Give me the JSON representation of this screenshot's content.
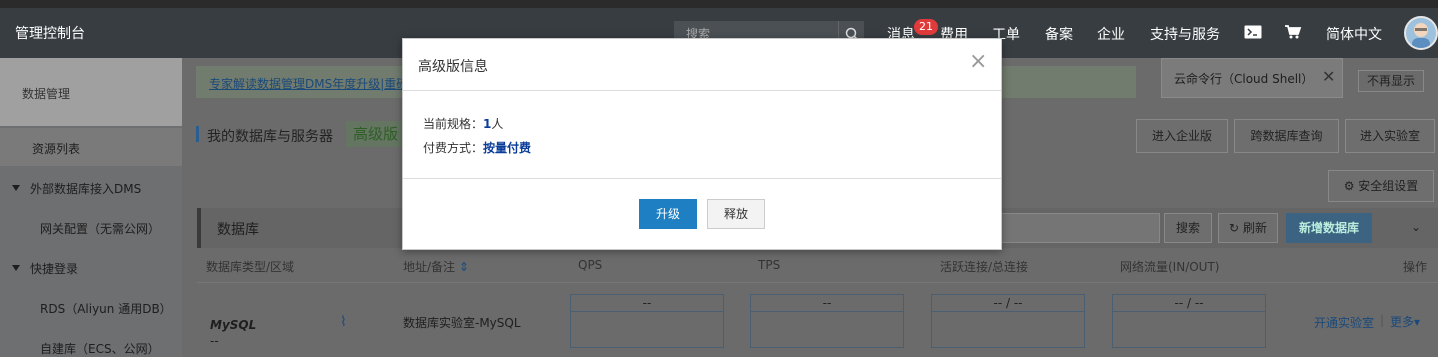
{
  "header": {
    "brand": "管理控制台",
    "search_placeholder": "搜索",
    "nav": {
      "messages": "消息",
      "messages_badge": "21",
      "billing": "费用",
      "tickets": "工单",
      "icp": "备案",
      "enterprise": "企业",
      "support": "支持与服务",
      "language": "简体中文"
    },
    "icons": [
      "search-icon",
      "terminal-icon",
      "cart-icon",
      "avatar"
    ]
  },
  "sidebar": {
    "section_title": "数据管理",
    "items": [
      {
        "label": "资源列表",
        "type": "item"
      },
      {
        "label": "外部数据库接入DMS",
        "type": "group"
      },
      {
        "label": "网关配置（无需公网）",
        "type": "subitem"
      },
      {
        "label": "快捷登录",
        "type": "group"
      },
      {
        "label": "RDS（Aliyun 通用DB）",
        "type": "subitem"
      },
      {
        "label": "自建库（ECS、公网）",
        "type": "subitem"
      }
    ]
  },
  "notice": {
    "link_text": "专家解读数据管理DMS年度升级|重磅"
  },
  "cloud_shell_tip": {
    "label": "云命令行（Cloud Shell）",
    "hide_button": "不再显示"
  },
  "main": {
    "breadcrumb": "我的数据库与服务器",
    "tag": "高级版",
    "top_buttons": [
      "进入企业版",
      "跨数据库查询",
      "进入实验室"
    ],
    "security_button": "安全组设置",
    "panel_title": "数据库",
    "search_button": "搜索",
    "refresh_button": "刷新",
    "new_db_button": "新增数据库",
    "table": {
      "headers": [
        "数据库类型/区域",
        "地址/备注",
        "QPS",
        "TPS",
        "活跃连接/总连接",
        "网络流量(IN/OUT)",
        "操作"
      ],
      "rows": [
        {
          "type": "MySQL",
          "region": "--",
          "address": "数据库实验室-MySQL",
          "qps": "--",
          "tps": "--",
          "connections": "-- / --",
          "traffic": "-- / --",
          "action_primary": "开通实验室",
          "action_more": "更多"
        }
      ]
    }
  },
  "modal": {
    "title": "高级版信息",
    "spec_label": "当前规格：",
    "spec_value": "1",
    "spec_unit": "人",
    "pay_label": "付费方式：",
    "pay_value": "按量付费",
    "upgrade_button": "升级",
    "release_button": "释放"
  }
}
